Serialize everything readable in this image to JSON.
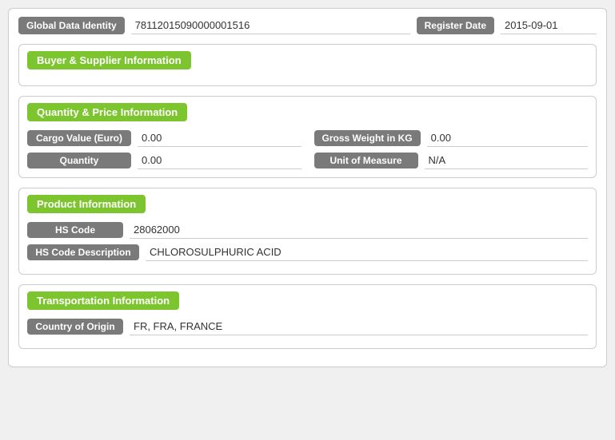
{
  "header": {
    "gdi_label": "Global Data Identity",
    "gdi_value": "78112015090000001516",
    "register_date_label": "Register Date",
    "register_date_value": "2015-09-01"
  },
  "sections": {
    "buyer_supplier": {
      "title": "Buyer & Supplier Information"
    },
    "quantity_price": {
      "title": "Quantity & Price Information",
      "cargo_value_label": "Cargo Value (Euro)",
      "cargo_value": "0.00",
      "gross_weight_label": "Gross Weight in KG",
      "gross_weight": "0.00",
      "quantity_label": "Quantity",
      "quantity": "0.00",
      "unit_of_measure_label": "Unit of Measure",
      "unit_of_measure": "N/A"
    },
    "product": {
      "title": "Product Information",
      "hs_code_label": "HS Code",
      "hs_code": "28062000",
      "hs_code_desc_label": "HS Code Description",
      "hs_code_desc": "CHLOROSULPHURIC ACID"
    },
    "transportation": {
      "title": "Transportation Information",
      "country_of_origin_label": "Country of Origin",
      "country_of_origin": "FR, FRA, FRANCE"
    }
  }
}
